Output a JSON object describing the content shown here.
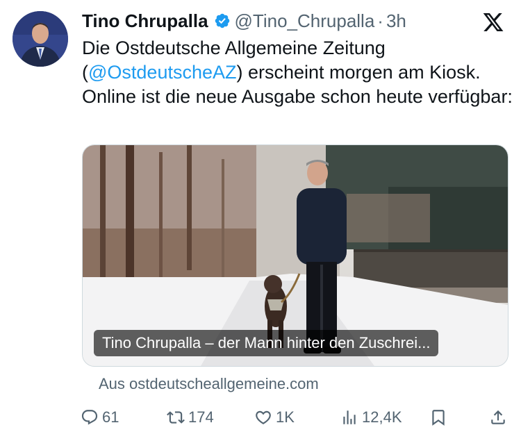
{
  "tweet": {
    "author_name": "Tino Chrupalla",
    "handle": "@Tino_Chrupalla",
    "separator": "·",
    "time": "3h",
    "text_before": "Die Ostdeutsche Allgemeine Zeitung (",
    "mention": "@OstdeutscheAZ",
    "text_after": ") erscheint morgen am Kiosk. Online ist die neue Ausgabe schon heute verfügbar:"
  },
  "card": {
    "title": "Tino Chrupalla – der Mann hinter den Zuschrei...",
    "source": "Aus ostdeutscheallgemeine.com"
  },
  "actions": {
    "replies": "61",
    "reposts": "174",
    "likes": "1K",
    "views": "12,4K"
  },
  "icons": [
    "verified-badge-icon",
    "x-logo-icon",
    "reply-icon",
    "repost-icon",
    "like-icon",
    "views-icon",
    "bookmark-icon",
    "share-icon"
  ],
  "colors": {
    "accent": "#1d9bf0",
    "text": "#0f1419",
    "secondary": "#536471"
  }
}
